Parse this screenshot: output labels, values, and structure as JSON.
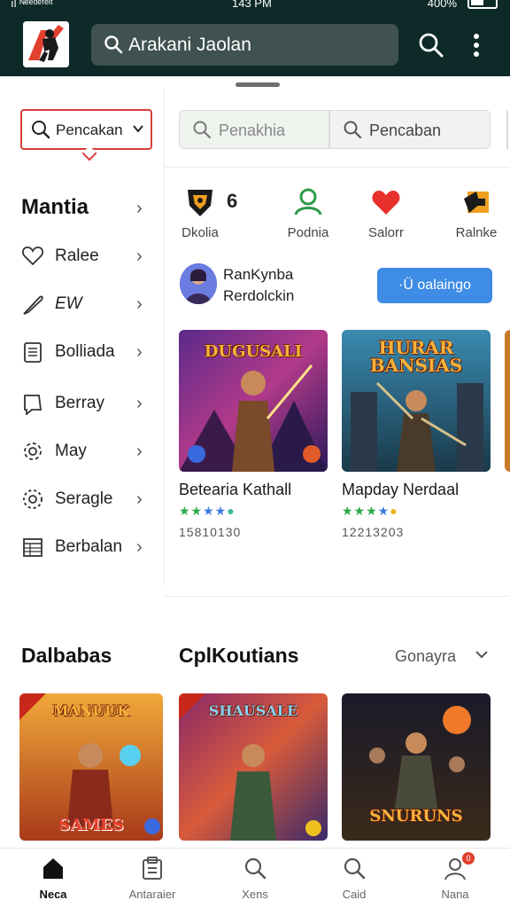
{
  "status_bar": {
    "left_text": "ıl ᴺᵉᵉᵈᵉᶠᵉᶦᵗ",
    "time": "143 PM",
    "battery": "400%"
  },
  "app_bar": {
    "search_text": "Arakani Jaolan",
    "icons": [
      "app-logo",
      "search-icon",
      "more-vert-icon"
    ]
  },
  "sidebar": {
    "dropdown_label": "Pencakan",
    "heading": "Mantia",
    "items": [
      {
        "label": "Ralee",
        "icon": "heart-icon"
      },
      {
        "label": "EW",
        "icon": "feather-icon"
      },
      {
        "label": "Bolliada",
        "icon": "calendar-icon"
      },
      {
        "label": "Berray",
        "icon": "book-icon"
      },
      {
        "label": "May",
        "icon": "gear-icon"
      },
      {
        "label": "Seragle",
        "icon": "settings-icon"
      },
      {
        "label": "Berbalan",
        "icon": "table-icon"
      }
    ],
    "section_title": "Dalbabas"
  },
  "filters": [
    {
      "label": "Penakhia",
      "icon": "search-icon"
    },
    {
      "label": "Pencaban",
      "icon": "search-icon"
    }
  ],
  "categories": {
    "count_label": "6",
    "items": [
      {
        "label": "Dkolia",
        "icon": "dragon-icon"
      },
      {
        "label": "Podnia",
        "icon": "user-icon"
      },
      {
        "label": "Salorr",
        "icon": "heart-icon"
      },
      {
        "label": "Ralnke",
        "icon": "game-logo-icon"
      }
    ]
  },
  "profile": {
    "name": "RanKynba",
    "subtitle": "Rerdolckin",
    "button_label": "·Ü oalaingo"
  },
  "featured_games": [
    {
      "title": "Betearia Kathall",
      "thumb_text": "DUGUSALI",
      "rating": 4.5,
      "count": "15810130"
    },
    {
      "title": "Mapday Nerdaal",
      "thumb_text": "HURAR BANSIAS",
      "rating": 4.5,
      "count": "12213203"
    }
  ],
  "section": {
    "title": "CplKoutians",
    "sort_label": "Gonayra"
  },
  "section_games": [
    {
      "thumb_text": "MANUUK",
      "bottom_text": "SAMES"
    },
    {
      "thumb_text": "SHAUSALE",
      "bottom_text": ""
    },
    {
      "thumb_text": "",
      "bottom_text": "SNURUNS"
    }
  ],
  "bottom_nav": [
    {
      "label": "Neca",
      "icon": "home-icon",
      "active": true
    },
    {
      "label": "Antaraier",
      "icon": "clipboard-icon",
      "active": false
    },
    {
      "label": "Xens",
      "icon": "search-icon",
      "active": false
    },
    {
      "label": "Caid",
      "icon": "search-icon",
      "active": false
    },
    {
      "label": "Nana",
      "icon": "person-icon",
      "active": false,
      "badge": "0"
    }
  ],
  "colors": {
    "app_bar": "#0e2a28",
    "accent_red": "#d6403a",
    "button_blue": "#3e8ce5"
  }
}
